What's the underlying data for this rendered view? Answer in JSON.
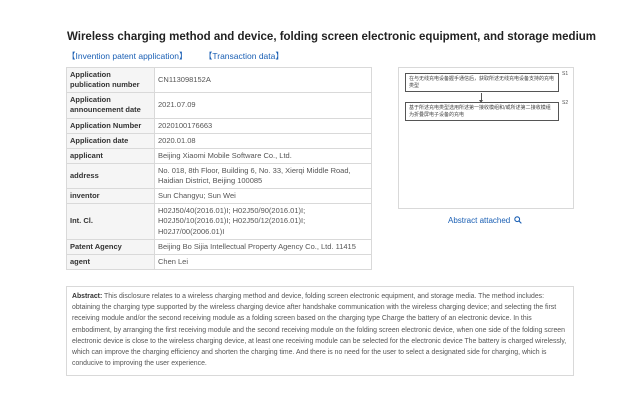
{
  "page": {
    "title": "Wireless charging method and device, folding screen electronic equipment, and storage medium",
    "links": [
      "【Invention patent application】",
      "【Transaction data】"
    ]
  },
  "info_rows": [
    {
      "key": "Application publication number",
      "value": "CN113098152A"
    },
    {
      "key": "Application announcement date",
      "value": "2021.07.09"
    },
    {
      "key": "Application Number",
      "value": "2020100176663"
    },
    {
      "key": "Application date",
      "value": "2020.01.08"
    },
    {
      "key": "applicant",
      "value": "Beijing Xiaomi Mobile Software Co., Ltd."
    },
    {
      "key": "address",
      "value": "No. 018, 8th Floor, Building 6, No. 33, Xierqi Middle Road, Haidian District, Beijing 100085"
    },
    {
      "key": "inventor",
      "value": "Sun Changyu; Sun Wei"
    },
    {
      "key": "Int. Cl.",
      "value": "H02J50/40(2016.01)I; H02J50/90(2016.01)I; H02J50/10(2016.01)I; H02J50/12(2016.01)I; H02J7/00(2006.01)I"
    },
    {
      "key": "Patent Agency",
      "value": "Beijing Bo Sijia Intellectual Property Agency Co., Ltd. 11415"
    },
    {
      "key": "agent",
      "value": "Chen Lei"
    }
  ],
  "figure": {
    "box1": "在与无线充电设备握手通信后，获取所述无线充电设备支持的充电类型",
    "box2": "基于所述充电类型选用所述第一接收模组和/或所述第二接收模组为折叠屏电子设备的充电",
    "ref1": "S1",
    "ref2": "S2"
  },
  "abstract_link": "Abstract attached",
  "abstract": {
    "label": "Abstract:",
    "text": "This disclosure relates to a wireless charging method and device, folding screen electronic equipment, and storage media. The method includes: obtaining the charging type supported by the wireless charging device after handshake communication with the wireless charging device; and selecting the first receiving module and/or the second receiving module as a folding screen based on the charging type Charge the battery of an electronic device. In this embodiment, by arranging the first receiving module and the second receiving module on the folding screen electronic device, when one side of the folding screen electronic device is close to the wireless charging device, at least one receiving module can be selected for the electronic device The battery is charged wirelessly, which can improve the charging efficiency and shorten the charging time. And there is no need for the user to select a designated side for charging, which is conducive to improving the user experience."
  }
}
